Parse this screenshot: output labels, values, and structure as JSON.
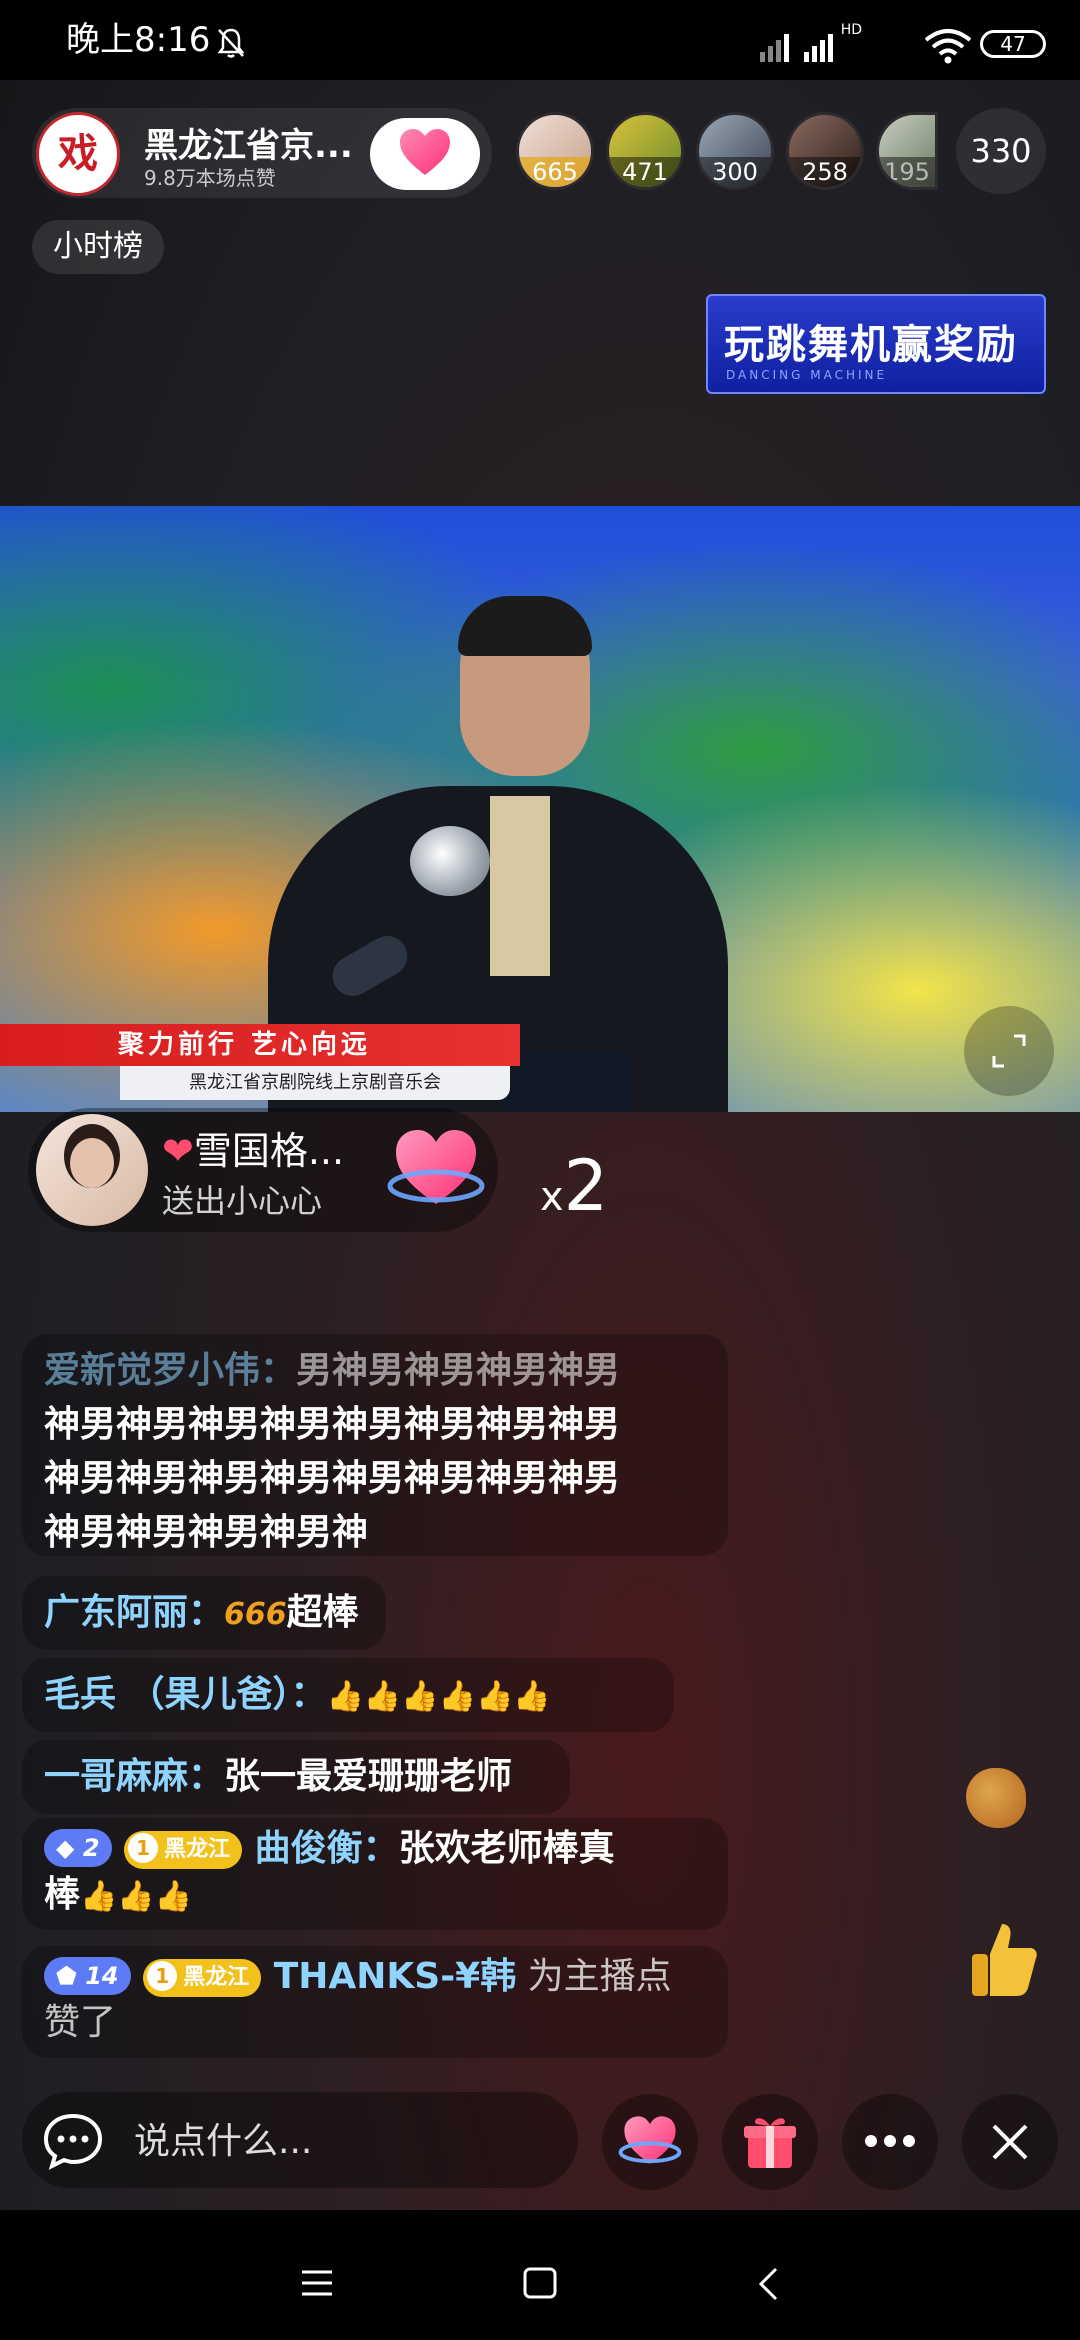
{
  "status_bar": {
    "time": "晚上8:16",
    "network": "HD",
    "battery": "47"
  },
  "host": {
    "name": "黑龙江省京...",
    "likes": "9.8万本场点赞"
  },
  "viewers": {
    "top": [
      {
        "badge": "665",
        "color": "#d9b8a8"
      },
      {
        "badge": "471",
        "color": "#9fa63a"
      },
      {
        "badge": "300",
        "color": "#5a6b80"
      },
      {
        "badge": "258",
        "color": "#6b4a3f"
      },
      {
        "badge": "195",
        "color": "#8e9a88"
      }
    ],
    "count": "330"
  },
  "rank_tag": "小时榜",
  "promo": {
    "title": "玩跳舞机赢奖励",
    "sub": "DANCING MACHINE"
  },
  "video": {
    "caption_main": "聚力前行  艺心向远",
    "caption_sub": "黑龙江省京剧院线上京剧音乐会"
  },
  "gift": {
    "user": "雪国格...",
    "action": "送出小心心",
    "multiplier_prefix": "x",
    "multiplier": "2"
  },
  "chat": [
    {
      "user": "爱新觉罗小伟：",
      "text_first": "男神男神男神男神男",
      "text_rest": [
        "神男神男神男神男神男神男神男神男",
        "神男神男神男神男神男神男神男神男",
        "神男神男神男神男神"
      ]
    },
    {
      "user": "广东阿丽：",
      "emoji": "666",
      "text": "超棒"
    },
    {
      "user": "毛兵 （果儿爸）：",
      "emoji": "👍👍👍👍👍👍"
    },
    {
      "user": "一哥麻麻：",
      "text": "张一最爱珊珊老师"
    },
    {
      "level": "2",
      "club": "黑龙江",
      "user": "曲俊衡：",
      "text": "张欢老师棒真",
      "text2": "棒",
      "emoji": "👍👍👍"
    },
    {
      "level": "14",
      "club": "黑龙江",
      "user": "THANKS-¥韩",
      "text": " 为主播点",
      "text2": "赞了"
    }
  ],
  "input": {
    "placeholder": "说点什么..."
  },
  "colors": {
    "accent": "#8fd3ff",
    "heart": "#ff4d8d"
  }
}
